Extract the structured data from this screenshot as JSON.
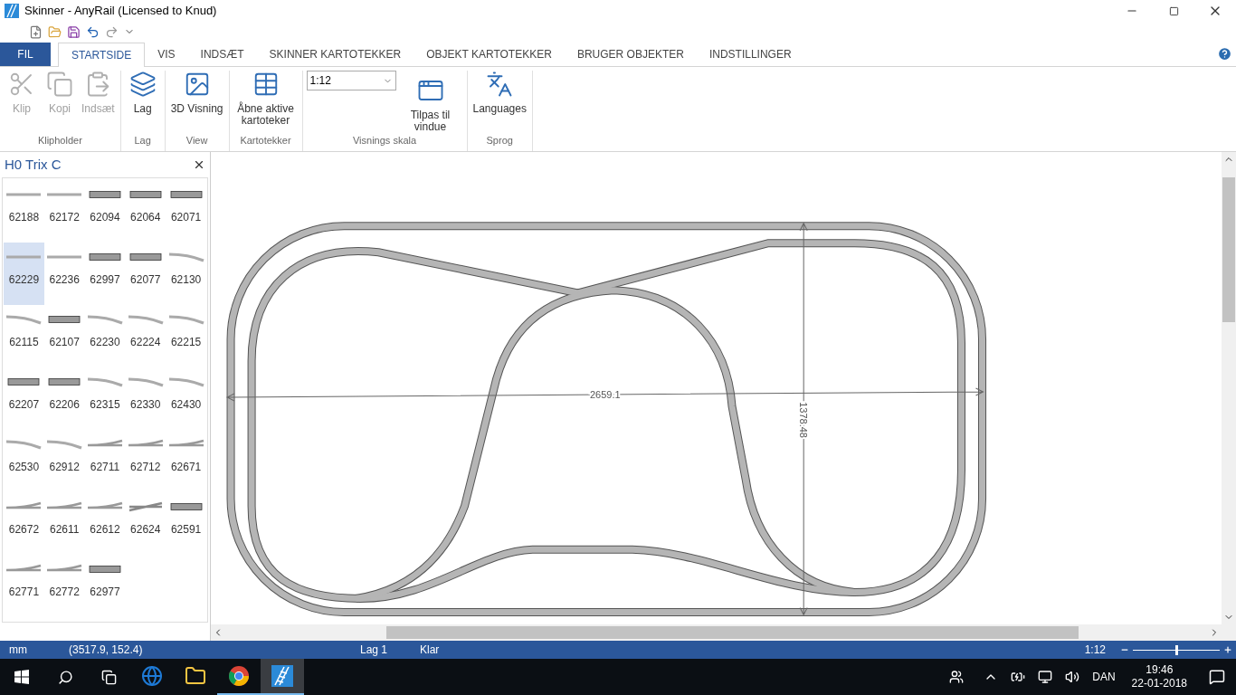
{
  "window": {
    "title": "Skinner - AnyRail (Licensed to Knud)"
  },
  "ribbon_tabs": [
    {
      "label": "FIL",
      "kind": "file",
      "selected": false
    },
    {
      "label": "STARTSIDE",
      "kind": "tab",
      "selected": true
    },
    {
      "label": "VIS",
      "kind": "tab",
      "selected": false
    },
    {
      "label": "INDSÆT",
      "kind": "tab",
      "selected": false
    },
    {
      "label": "SKINNER KARTOTEKKER",
      "kind": "tab",
      "selected": false
    },
    {
      "label": "OBJEKT KARTOTEKKER",
      "kind": "tab",
      "selected": false
    },
    {
      "label": "BRUGER OBJEKTER",
      "kind": "tab",
      "selected": false
    },
    {
      "label": "INDSTILLINGER",
      "kind": "tab",
      "selected": false
    }
  ],
  "ribbon_groups": [
    {
      "label": "Klipholder",
      "buttons": [
        {
          "label": "Klip",
          "disabled": true
        },
        {
          "label": "Kopi",
          "disabled": true
        },
        {
          "label": "Indsæt",
          "disabled": true
        }
      ]
    },
    {
      "label": "Lag",
      "buttons": [
        {
          "label": "Lag",
          "disabled": false
        }
      ]
    },
    {
      "label": "View",
      "buttons": [
        {
          "label": "3D Visning",
          "disabled": false
        }
      ]
    },
    {
      "label": "Kartotekker",
      "buttons": [
        {
          "label": "Åbne aktive kartoteker",
          "disabled": false
        }
      ]
    },
    {
      "label": "Visnings skala",
      "scale_value": "1:12",
      "buttons": [
        {
          "label": "Tilpas til vindue",
          "disabled": false
        }
      ]
    },
    {
      "label": "Sprog",
      "buttons": [
        {
          "label": "Languages",
          "disabled": false
        }
      ]
    }
  ],
  "panel": {
    "title": "H0 Trix C",
    "items": [
      {
        "label": "62188",
        "kind": "straight",
        "selected": false
      },
      {
        "label": "62172",
        "kind": "straight",
        "selected": false
      },
      {
        "label": "62094",
        "kind": "wide",
        "selected": false
      },
      {
        "label": "62064",
        "kind": "wide",
        "selected": false
      },
      {
        "label": "62071",
        "kind": "wide",
        "selected": false
      },
      {
        "label": "62229",
        "kind": "straight",
        "selected": true
      },
      {
        "label": "62236",
        "kind": "straight",
        "selected": false
      },
      {
        "label": "62997",
        "kind": "wide",
        "selected": false
      },
      {
        "label": "62077",
        "kind": "wide",
        "selected": false
      },
      {
        "label": "62130",
        "kind": "curve",
        "selected": false
      },
      {
        "label": "62115",
        "kind": "curve",
        "selected": false
      },
      {
        "label": "62107",
        "kind": "wide",
        "selected": false
      },
      {
        "label": "62230",
        "kind": "curve",
        "selected": false
      },
      {
        "label": "62224",
        "kind": "curve",
        "selected": false
      },
      {
        "label": "62215",
        "kind": "curve",
        "selected": false
      },
      {
        "label": "62207",
        "kind": "wide",
        "selected": false
      },
      {
        "label": "62206",
        "kind": "wide",
        "selected": false
      },
      {
        "label": "62315",
        "kind": "curve",
        "selected": false
      },
      {
        "label": "62330",
        "kind": "curve",
        "selected": false
      },
      {
        "label": "62430",
        "kind": "curve",
        "selected": false
      },
      {
        "label": "62530",
        "kind": "curve",
        "selected": false
      },
      {
        "label": "62912",
        "kind": "curve",
        "selected": false
      },
      {
        "label": "62711",
        "kind": "switch",
        "selected": false
      },
      {
        "label": "62712",
        "kind": "switch",
        "selected": false
      },
      {
        "label": "62671",
        "kind": "switch",
        "selected": false
      },
      {
        "label": "62672",
        "kind": "switch",
        "selected": false
      },
      {
        "label": "62611",
        "kind": "switch",
        "selected": false
      },
      {
        "label": "62612",
        "kind": "switch",
        "selected": false
      },
      {
        "label": "62624",
        "kind": "crossing",
        "selected": false
      },
      {
        "label": "62591",
        "kind": "wide",
        "selected": false
      },
      {
        "label": "62771",
        "kind": "switch",
        "selected": false
      },
      {
        "label": "62772",
        "kind": "switch",
        "selected": false
      },
      {
        "label": "62977",
        "kind": "wide",
        "selected": false
      }
    ]
  },
  "canvas": {
    "width_dimension": "2659.1",
    "height_dimension": "1378.48"
  },
  "status_bar": {
    "unit": "mm",
    "coordinates": "(3517.9, 152.4)",
    "layer": "Lag 1",
    "state": "Klar",
    "scale": "1:12",
    "zoom": {
      "level": 0.5
    }
  },
  "taskbar": {
    "apps": [
      {
        "running": false,
        "selected": false
      },
      {
        "running": false,
        "selected": false
      },
      {
        "running": true,
        "selected": false
      },
      {
        "running": true,
        "selected": true
      }
    ],
    "language": "DAN",
    "time": "19:46",
    "date": "22-01-2018"
  }
}
